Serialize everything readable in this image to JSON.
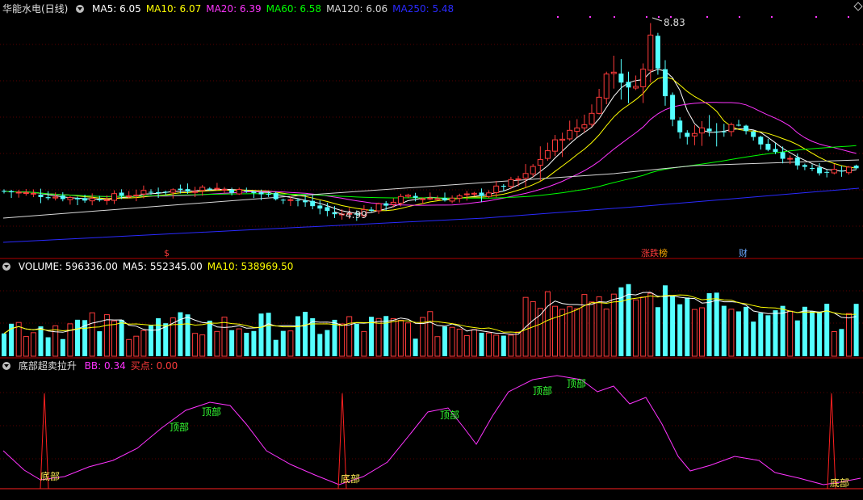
{
  "colors": {
    "up": "#ff3b3b",
    "down": "#54ffff",
    "ma5": "#ffffff",
    "ma10": "#ffff00",
    "ma20": "#ff33ff",
    "ma60": "#00ff00",
    "ma120": "#d9d9d9",
    "ma250": "#2a2aff",
    "grid": "#5a0000",
    "separator": "#b00000"
  },
  "main_pane": {
    "title": "华能水电(日线)",
    "ma_labels": [
      {
        "text": "MA5: 6.05",
        "color": "#ffffff"
      },
      {
        "text": "MA10: 6.07",
        "color": "#ffff00"
      },
      {
        "text": "MA20: 6.39",
        "color": "#ff33ff"
      },
      {
        "text": "MA60: 6.58",
        "color": "#00ff00"
      },
      {
        "text": "MA120: 6.06",
        "color": "#d9d9d9"
      },
      {
        "text": "MA250: 5.48",
        "color": "#2a2aff"
      }
    ],
    "high_label": "8.83",
    "low_label": "4.99",
    "markers": [
      {
        "text": "$",
        "color": "#ff3b3b"
      },
      {
        "text": "涨跌",
        "color": "#ff3b3b"
      },
      {
        "text": "榜",
        "color": "#ffaa00"
      },
      {
        "text": "财",
        "color": "#6aa8ff"
      }
    ]
  },
  "volume_pane": {
    "labels": [
      {
        "text": "VOLUME: 596336.00",
        "color": "#ffffff"
      },
      {
        "text": "MA5: 552345.00",
        "color": "#ffffff"
      },
      {
        "text": "MA10: 538969.50",
        "color": "#ffff00"
      }
    ]
  },
  "indicator_pane": {
    "name": "底部超卖拉升",
    "labels": [
      {
        "text": "BB: 0.34",
        "color": "#ff33ff"
      },
      {
        "text": "买点: 0.00",
        "color": "#ff3b3b"
      }
    ],
    "top_label": "顶部",
    "bottom_label": "底部"
  },
  "chart_data": {
    "type": "candlestick",
    "price_high": 8.83,
    "price_low": 4.99
  }
}
